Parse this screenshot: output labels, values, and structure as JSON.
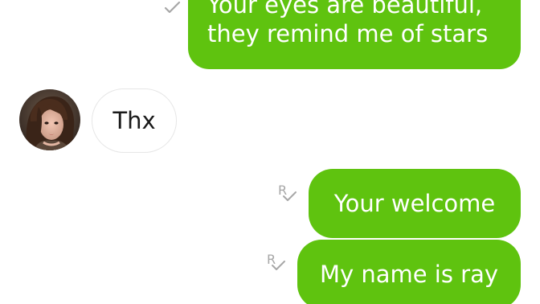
{
  "messages": [
    {
      "id": "msg1",
      "direction": "outgoing",
      "lines": [
        "Your eyes are beautiful,",
        "they remind me of stars"
      ],
      "read_receipt": "R"
    },
    {
      "id": "msg2",
      "direction": "incoming",
      "text": "Thx",
      "sender_avatar": "profile-photo"
    },
    {
      "id": "msg3",
      "direction": "outgoing",
      "text": "Your welcome",
      "read_receipt": "R"
    },
    {
      "id": "msg4",
      "direction": "outgoing",
      "text": "My name is ray",
      "read_receipt": "R"
    }
  ],
  "colors": {
    "outgoing_bubble": "#5fc30f",
    "outgoing_text": "#ffffff",
    "incoming_bubble": "#ffffff",
    "incoming_text": "#1a1a1a",
    "receipt": "#a7a7a7",
    "background": "#ffffff"
  },
  "icons": {
    "read_receipt": "read-receipt-icon",
    "avatar": "avatar"
  }
}
